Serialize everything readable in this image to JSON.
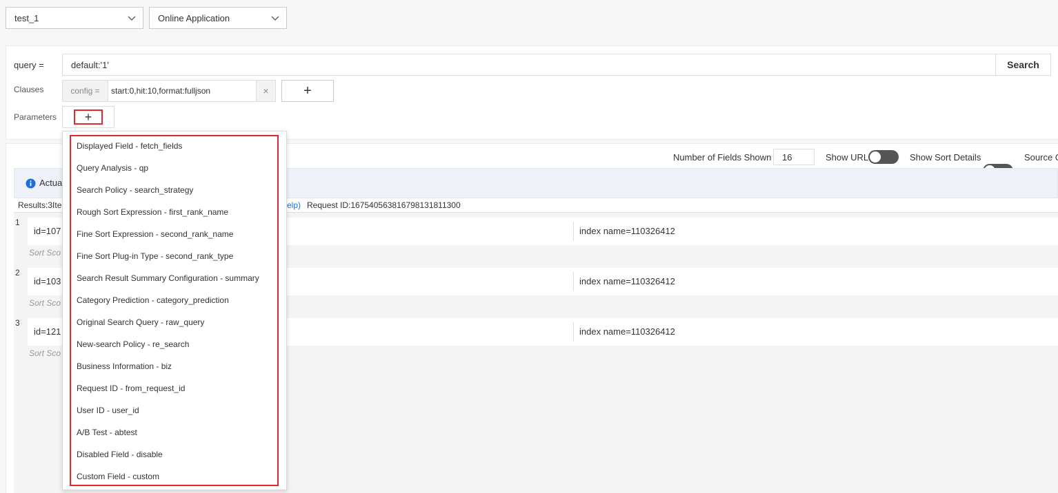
{
  "top_selects": {
    "instance": "test_1",
    "environment": "Online Application"
  },
  "query": {
    "label": "query =",
    "value": "default:'1'",
    "search_label": "Search"
  },
  "clauses": {
    "label": "Clauses",
    "config_prefix": "config =",
    "config_value": "start:0,hit:10,format:fulljson",
    "clear_glyph": "×",
    "add_glyph": "+"
  },
  "parameters": {
    "label": "Parameters",
    "add_glyph": "+"
  },
  "results_toolbar": {
    "fields_shown_label": "Number of Fields Shown",
    "fields_shown_value": "16",
    "show_url_label": "Show URL",
    "show_sort_details_label": "Show Sort Details",
    "source_label": "Source C"
  },
  "info_bar": {
    "text": "Actua"
  },
  "results_summary": {
    "prefix": "Results:3Ite",
    "help_link": "elp)",
    "request_id": "Request ID:167540563816798131811300"
  },
  "results": [
    {
      "index": "1",
      "id_text": "id=107",
      "index_name": "index name=110326412",
      "sort_text": "Sort Sco"
    },
    {
      "index": "2",
      "id_text": "id=103",
      "index_name": "index name=110326412",
      "sort_text": "Sort Sco"
    },
    {
      "index": "3",
      "id_text": "id=121",
      "index_name": "index name=110326412",
      "sort_text": "Sort Sco"
    }
  ],
  "dropdown": {
    "items": [
      "Displayed Field - fetch_fields",
      "Query Analysis - qp",
      "Search Policy - search_strategy",
      "Rough Sort Expression - first_rank_name",
      "Fine Sort Expression - second_rank_name",
      "Fine Sort Plug-in Type - second_rank_type",
      "Search Result Summary Configuration - summary",
      "Category Prediction - category_prediction",
      "Original Search Query - raw_query",
      "New-search Policy - re_search",
      "Business Information - biz",
      "Request ID - from_request_id",
      "User ID - user_id",
      "A/B Test - abtest",
      "Disabled Field - disable",
      "Custom Field - custom"
    ]
  },
  "colors": {
    "highlight_red": "#e3262c",
    "info_blue": "#1e6fd9",
    "toggle_off": "#555555"
  },
  "icons": [
    "chevron-down-icon",
    "info-icon",
    "plus-icon",
    "close-icon"
  ]
}
